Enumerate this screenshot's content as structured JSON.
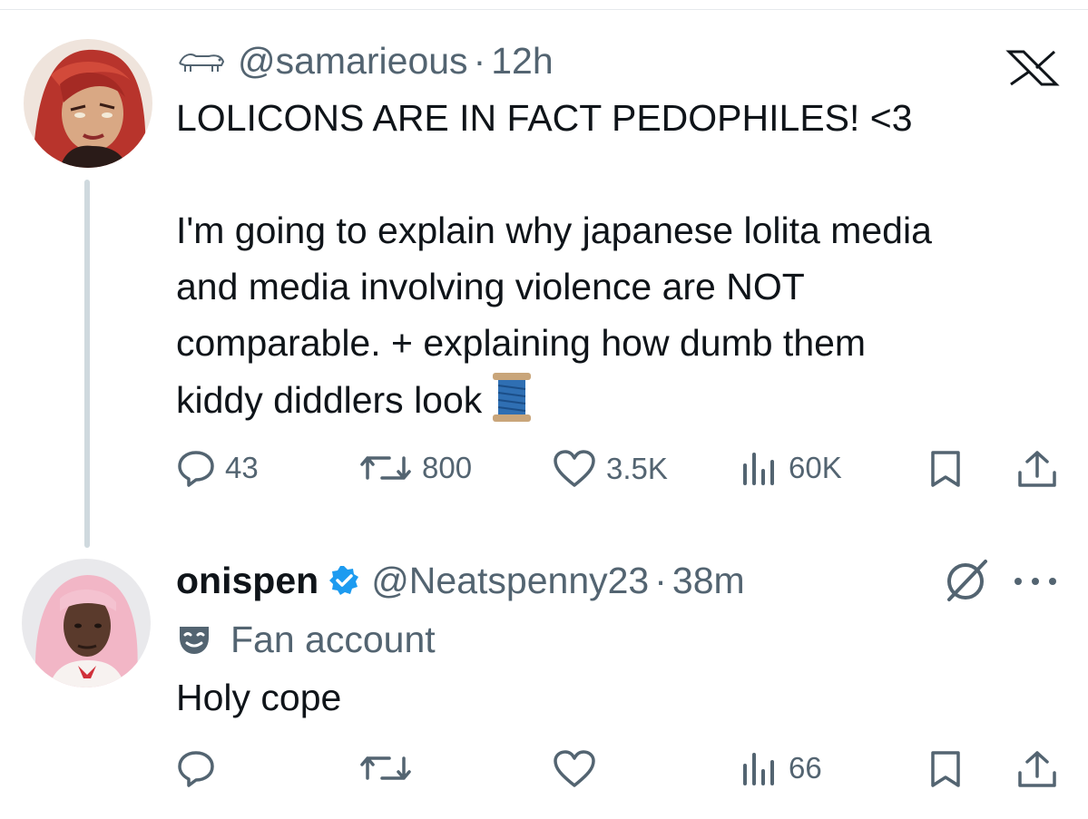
{
  "tweet1": {
    "handle": "@samarieous",
    "separator": "·",
    "time": "12h",
    "line1": "LOLICONS ARE IN FACT PEDOPHILES! <3",
    "body_lines": [
      "I'm going to explain why japanese lolita media",
      "and media involving violence are NOT",
      "comparable. + explaining how dumb them",
      "kiddy diddlers look"
    ],
    "spool_emoji": "🧵",
    "actions": {
      "replies": "43",
      "reposts": "800",
      "likes": "3.5K",
      "views": "60K"
    }
  },
  "tweet2": {
    "display_name": "onispen",
    "handle": "@Neatspenny23",
    "separator": "·",
    "time": "38m",
    "label": "Fan account",
    "text": "Holy cope",
    "actions": {
      "replies": "",
      "reposts": "",
      "likes": "",
      "views": "66"
    }
  },
  "icons": {
    "brand": "x-logo-icon",
    "grok": "grok-icon",
    "more": "more-icon",
    "reply": "reply-icon",
    "repost": "repost-icon",
    "like": "heart-icon",
    "views": "views-icon",
    "bookmark": "bookmark-icon",
    "share": "share-icon",
    "verified": "verified-badge-icon",
    "fan_account": "mask-icon"
  },
  "colors": {
    "text": "#0f1419",
    "secondary": "#536471",
    "verified_blue": "#1d9bf0",
    "thread_line": "#cfd9de"
  }
}
